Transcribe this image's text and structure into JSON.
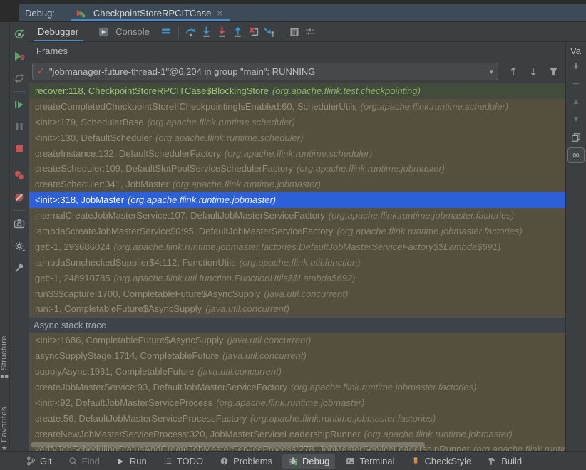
{
  "header": {
    "label": "Debug:",
    "tab_title": "CheckpointStoreRPCITCase"
  },
  "view_tabs": {
    "debugger": "Debugger",
    "console": "Console"
  },
  "frames_panel": {
    "title": "Frames",
    "thread_value": "\"jobmanager-future-thread-1\"@6,204 in group \"main\": RUNNING"
  },
  "right_panel": {
    "title": "Va"
  },
  "side_stripe": {
    "structure": "Structure",
    "favorites": "Favorites"
  },
  "frames": {
    "main": [
      {
        "text": "recover:118, CheckpointStoreRPCITCase$BlockingStore",
        "pkg": "(org.apache.flink.test.checkpointing)",
        "state": "current"
      },
      {
        "text": "createCompletedCheckpointStoreIfCheckpointingIsEnabled:60, SchedulerUtils",
        "pkg": "(org.apache.flink.runtime.scheduler)"
      },
      {
        "text": "<init>:179, SchedulerBase",
        "pkg": "(org.apache.flink.runtime.scheduler)"
      },
      {
        "text": "<init>:130, DefaultScheduler",
        "pkg": "(org.apache.flink.runtime.scheduler)"
      },
      {
        "text": "createInstance:132, DefaultSchedulerFactory",
        "pkg": "(org.apache.flink.runtime.scheduler)"
      },
      {
        "text": "createScheduler:109, DefaultSlotPoolServiceSchedulerFactory",
        "pkg": "(org.apache.flink.runtime.jobmaster)"
      },
      {
        "text": "createScheduler:341, JobMaster",
        "pkg": "(org.apache.flink.runtime.jobmaster)"
      },
      {
        "text": "<init>:318, JobMaster",
        "pkg": "(org.apache.flink.runtime.jobmaster)",
        "state": "selected"
      },
      {
        "text": "internalCreateJobMasterService:107, DefaultJobMasterServiceFactory",
        "pkg": "(org.apache.flink.runtime.jobmaster.factories)"
      },
      {
        "text": "lambda$createJobMasterService$0:95, DefaultJobMasterServiceFactory",
        "pkg": "(org.apache.flink.runtime.jobmaster.factories)"
      },
      {
        "text": "get:-1, 293686024",
        "pkg": "(org.apache.flink.runtime.jobmaster.factories.DefaultJobMasterServiceFactory$$Lambda$691)"
      },
      {
        "text": "lambda$uncheckedSupplier$4:112, FunctionUtils",
        "pkg": "(org.apache.flink.util.function)"
      },
      {
        "text": "get:-1, 248910785",
        "pkg": "(org.apache.flink.util.function.FunctionUtils$$Lambda$692)"
      },
      {
        "text": "run$$$capture:1700, CompletableFuture$AsyncSupply",
        "pkg": "(java.util.concurrent)"
      },
      {
        "text": "run:-1, CompletableFuture$AsyncSupply",
        "pkg": "(java.util.concurrent)"
      }
    ],
    "separator": "Async stack trace",
    "async": [
      {
        "text": "<init>:1686, CompletableFuture$AsyncSupply",
        "pkg": "(java.util.concurrent)"
      },
      {
        "text": "asyncSupplyStage:1714, CompletableFuture",
        "pkg": "(java.util.concurrent)"
      },
      {
        "text": "supplyAsync:1931, CompletableFuture",
        "pkg": "(java.util.concurrent)"
      },
      {
        "text": "createJobMasterService:93, DefaultJobMasterServiceFactory",
        "pkg": "(org.apache.flink.runtime.jobmaster.factories)"
      },
      {
        "text": "<init>:92, DefaultJobMasterServiceProcess",
        "pkg": "(org.apache.flink.runtime.jobmaster)"
      },
      {
        "text": "create:56, DefaultJobMasterServiceProcessFactory",
        "pkg": "(org.apache.flink.runtime.jobmaster.factories)"
      },
      {
        "text": "createNewJobMasterServiceProcess:320, JobMasterServiceLeadershipRunner",
        "pkg": "(org.apache.flink.runtime.jobmaster)"
      },
      {
        "text": "verifyJobSchedulingStatusAndCreateJobMasterServiceProcess:278, JobMasterServiceLeadershipRunner",
        "pkg": "(org.apache.flink.runtime.jobmaster)"
      }
    ]
  },
  "bottom_bar": {
    "items": [
      {
        "label": "Git"
      },
      {
        "label": "Find"
      },
      {
        "label": "Run"
      },
      {
        "label": "TODO"
      },
      {
        "label": "Problems"
      },
      {
        "label": "Debug"
      },
      {
        "label": "Terminal"
      },
      {
        "label": "CheckStyle"
      },
      {
        "label": "Build"
      }
    ]
  },
  "glyphs": {
    "close": "×",
    "chevron_down": "▾",
    "check": "✓",
    "arrow_up": "↑",
    "arrow_down": "↓",
    "plus": "+",
    "minus": "−",
    "tri_up": "▲",
    "tri_down": "▼",
    "copy": "⧉",
    "infinity": "∞",
    "star": "★",
    "structure_icon": "▪▪"
  },
  "colors": {
    "accent_blue": "#4a88c7",
    "selection_blue": "#2d60d8",
    "current_frame_green": "#a4c178",
    "icon_red": "#c75450",
    "icon_green": "#59a869",
    "checkmark_orange": "#c25e43",
    "frames_bg": "#544f3e"
  }
}
